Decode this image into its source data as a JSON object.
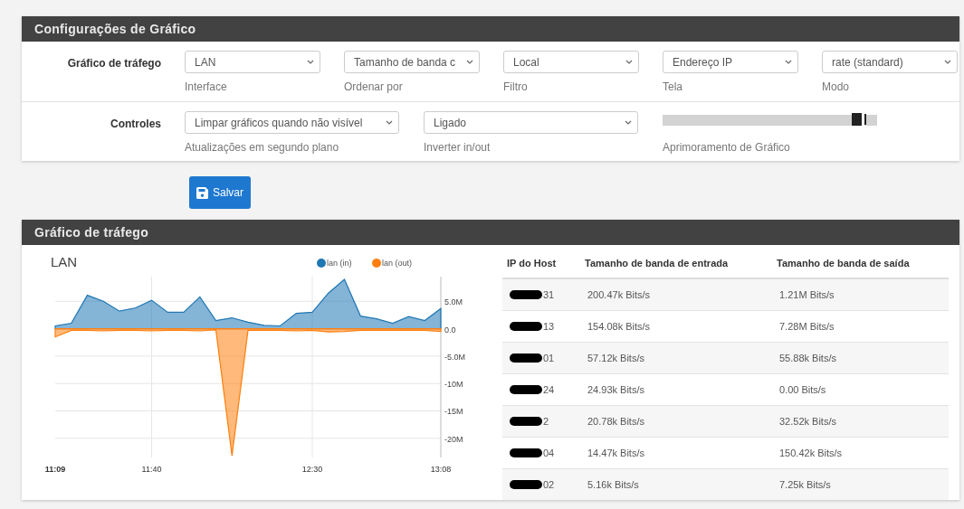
{
  "settings_panel": {
    "title": "Configurações de Gráfico",
    "rows": [
      {
        "label": "Gráfico de tráfego",
        "controls": [
          {
            "kind": "select",
            "value": "LAN",
            "caption": "Interface"
          },
          {
            "kind": "select",
            "value": "Tamanho de banda c",
            "caption": "Ordenar por"
          },
          {
            "kind": "select",
            "value": "Local",
            "caption": "Filtro"
          },
          {
            "kind": "select",
            "value": "Endereço IP",
            "caption": "Tela"
          },
          {
            "kind": "select",
            "value": "rate (standard)",
            "caption": "Modo"
          }
        ]
      },
      {
        "label": "Controles",
        "controls": [
          {
            "kind": "select",
            "value": "Limpar gráficos quando não visível",
            "caption": "Atualizações em segundo plano"
          },
          {
            "kind": "select",
            "value": "Ligado",
            "caption": "Inverter in/out"
          },
          {
            "kind": "slider",
            "level": 0.95,
            "caption": "Aprimoramento de Gráfico"
          }
        ]
      }
    ]
  },
  "save_button": {
    "label": "Salvar"
  },
  "traffic_panel": {
    "title": "Gráfico de tráfego",
    "chart": {
      "chart_data": {
        "type": "area",
        "title": "LAN",
        "categories": [
          "11:09",
          null,
          null,
          null,
          null,
          null,
          "11:40",
          null,
          null,
          null,
          null,
          null,
          null,
          null,
          null,
          null,
          "12:30",
          null,
          null,
          null,
          null,
          null,
          null,
          null,
          "13:08"
        ],
        "series": [
          {
            "name": "lan (in)",
            "color": "#1f77b4",
            "values": [
              0.5,
              1.0,
              6.1,
              5.0,
              3.2,
              3.8,
              5.2,
              3.0,
              3.0,
              5.8,
              1.5,
              2.0,
              1.2,
              0.6,
              0.5,
              2.8,
              3.0,
              6.5,
              9.0,
              2.3,
              1.8,
              1.0,
              2.2,
              1.5,
              3.7
            ]
          },
          {
            "name": "lan (out)",
            "color": "#ff7f0e",
            "values": [
              -1.5,
              -0.3,
              -0.3,
              -0.4,
              -0.3,
              -0.3,
              -0.4,
              -0.3,
              -0.3,
              -0.4,
              -0.2,
              -23.2,
              -0.3,
              -0.3,
              -0.3,
              -0.4,
              -0.3,
              -0.6,
              -0.5,
              -0.3,
              -0.3,
              -0.3,
              -0.3,
              -0.3,
              -0.5
            ]
          }
        ],
        "ylim": [
          -23.5,
          9.5
        ],
        "grid": true,
        "legend": "top-right",
        "yticks": [
          {
            "value": 5,
            "label": "5.0M"
          },
          {
            "value": 0,
            "label": "0.0"
          },
          {
            "value": -5,
            "label": "-5.0M"
          },
          {
            "value": -10,
            "label": "-10M"
          },
          {
            "value": -15,
            "label": "-15M"
          },
          {
            "value": -20,
            "label": "-20M"
          }
        ]
      }
    },
    "table": {
      "columns": [
        "IP do Host",
        "Tamanho de banda de entrada",
        "Tamanho de banda de saída"
      ],
      "rows": [
        {
          "host_ip": "31",
          "redacted": true,
          "in": "200.47k Bits/s",
          "out": "1.21M Bits/s"
        },
        {
          "host_ip": "13",
          "redacted": true,
          "in": "154.08k Bits/s",
          "out": "7.28M Bits/s"
        },
        {
          "host_ip": "01",
          "redacted": true,
          "in": "57.12k Bits/s",
          "out": "55.88k Bits/s"
        },
        {
          "host_ip": "24",
          "redacted": true,
          "in": "24.93k Bits/s",
          "out": "0.00 Bits/s"
        },
        {
          "host_ip": "2",
          "redacted": true,
          "in": "20.78k Bits/s",
          "out": "32.52k Bits/s"
        },
        {
          "host_ip": "04",
          "redacted": true,
          "in": "14.47k Bits/s",
          "out": "150.42k Bits/s"
        },
        {
          "host_ip": "02",
          "redacted": true,
          "in": "5.16k Bits/s",
          "out": "7.25k Bits/s"
        }
      ]
    }
  }
}
